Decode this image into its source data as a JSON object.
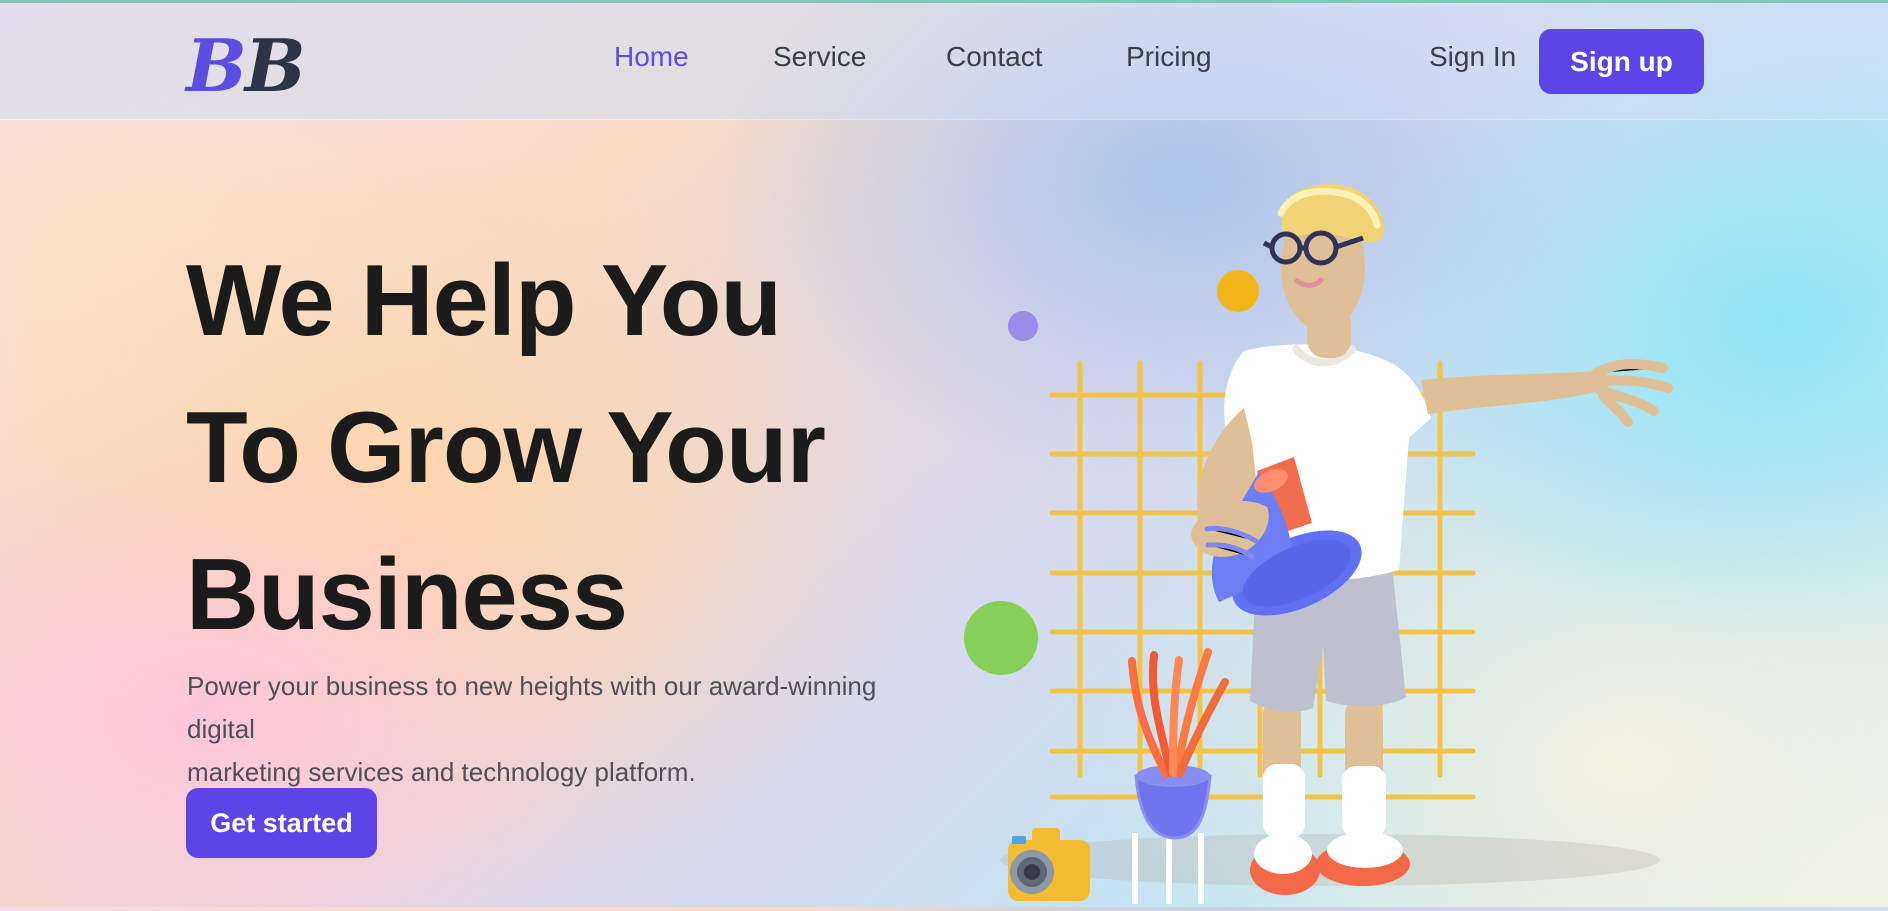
{
  "header": {
    "logo_primary": "B",
    "logo_secondary": "B",
    "nav_items": [
      {
        "label": "Home",
        "active": true
      },
      {
        "label": "Service",
        "active": false
      },
      {
        "label": "Contact",
        "active": false
      },
      {
        "label": "Pricing",
        "active": false
      }
    ],
    "sign_in_label": "Sign In",
    "sign_up_label": "Sign up"
  },
  "hero": {
    "title_lines": [
      "We Help You",
      "To Grow Your",
      "Business"
    ],
    "subtitle_lines": [
      "Power your business to new heights with our award-winning digital",
      "marketing services and technology platform."
    ],
    "cta_label": "Get started"
  },
  "colors": {
    "accent": "#5b45e6",
    "text_dark": "#1b1b1b",
    "nav_text": "#3b3f48",
    "subtitle_text": "#4f4f58"
  },
  "illustration": {
    "name": "hero-3d-illustration",
    "elements": [
      "person-with-megaphone",
      "yellow-grid",
      "plant-pot",
      "camera",
      "decorative-dots"
    ]
  }
}
